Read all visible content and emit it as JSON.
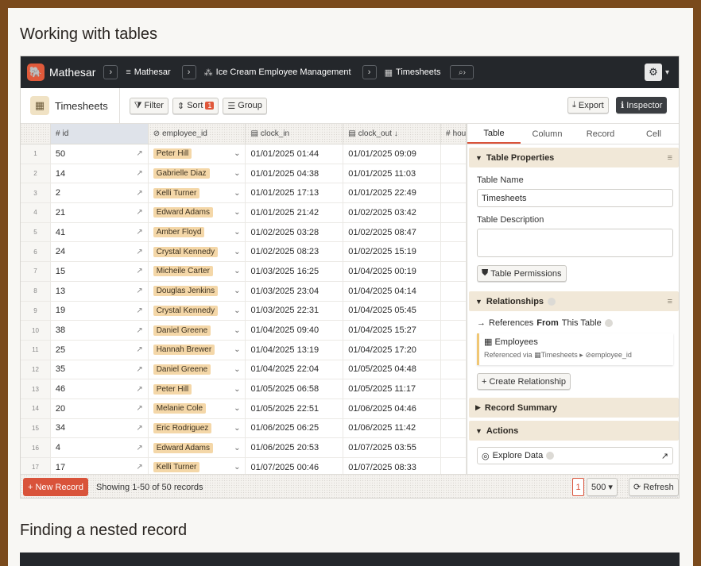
{
  "headings": {
    "working": "Working with tables",
    "finding": "Finding a nested record"
  },
  "topbar": {
    "brand": "Mathesar",
    "crumbs": [
      {
        "icon": "database-icon",
        "glyph": "≡",
        "label": "Mathesar"
      },
      {
        "icon": "schema-icon",
        "glyph": "⁂",
        "label": "Ice Cream Employee Management"
      },
      {
        "icon": "table-icon",
        "glyph": "▦",
        "label": "Timesheets"
      }
    ]
  },
  "toolbar": {
    "table_name": "Timesheets",
    "filter": "Filter",
    "sort": "Sort",
    "sort_count": "1",
    "group": "Group",
    "export": "Export",
    "inspector": "Inspector"
  },
  "columns": [
    {
      "glyph": "#",
      "label": "id"
    },
    {
      "glyph": "⊘",
      "label": "employee_id"
    },
    {
      "glyph": "▤",
      "label": "clock_in"
    },
    {
      "glyph": "▤",
      "label": "clock_out ↓"
    },
    {
      "glyph": "#",
      "label": "hou"
    }
  ],
  "rows": [
    {
      "n": "1",
      "id": "50",
      "emp": "Peter Hill",
      "in": "01/01/2025 01:44",
      "out": "01/01/2025 09:09"
    },
    {
      "n": "2",
      "id": "14",
      "emp": "Gabrielle Diaz",
      "in": "01/01/2025 04:38",
      "out": "01/01/2025 11:03"
    },
    {
      "n": "3",
      "id": "2",
      "emp": "Kelli Turner",
      "in": "01/01/2025 17:13",
      "out": "01/01/2025 22:49"
    },
    {
      "n": "4",
      "id": "21",
      "emp": "Edward Adams",
      "in": "01/01/2025 21:42",
      "out": "01/02/2025 03:42"
    },
    {
      "n": "5",
      "id": "41",
      "emp": "Amber Floyd",
      "in": "01/02/2025 03:28",
      "out": "01/02/2025 08:47"
    },
    {
      "n": "6",
      "id": "24",
      "emp": "Crystal Kennedy",
      "in": "01/02/2025 08:23",
      "out": "01/02/2025 15:19"
    },
    {
      "n": "7",
      "id": "15",
      "emp": "Micheile Carter",
      "in": "01/03/2025 16:25",
      "out": "01/04/2025 00:19"
    },
    {
      "n": "8",
      "id": "13",
      "emp": "Douglas Jenkins",
      "in": "01/03/2025 23:04",
      "out": "01/04/2025 04:14"
    },
    {
      "n": "9",
      "id": "19",
      "emp": "Crystal Kennedy",
      "in": "01/03/2025 22:31",
      "out": "01/04/2025 05:45"
    },
    {
      "n": "10",
      "id": "38",
      "emp": "Daniel Greene",
      "in": "01/04/2025 09:40",
      "out": "01/04/2025 15:27"
    },
    {
      "n": "11",
      "id": "25",
      "emp": "Hannah Brewer",
      "in": "01/04/2025 13:19",
      "out": "01/04/2025 17:20"
    },
    {
      "n": "12",
      "id": "35",
      "emp": "Daniel Greene",
      "in": "01/04/2025 22:04",
      "out": "01/05/2025 04:48"
    },
    {
      "n": "13",
      "id": "46",
      "emp": "Peter Hill",
      "in": "01/05/2025 06:58",
      "out": "01/05/2025 11:17"
    },
    {
      "n": "14",
      "id": "20",
      "emp": "Melanie Cole",
      "in": "01/05/2025 22:51",
      "out": "01/06/2025 04:46"
    },
    {
      "n": "15",
      "id": "34",
      "emp": "Eric Rodriguez",
      "in": "01/06/2025 06:25",
      "out": "01/06/2025 11:42"
    },
    {
      "n": "16",
      "id": "4",
      "emp": "Edward Adams",
      "in": "01/06/2025 20:53",
      "out": "01/07/2025 03:55"
    },
    {
      "n": "17",
      "id": "17",
      "emp": "Kelli Turner",
      "in": "01/07/2025 00:46",
      "out": "01/07/2025 08:33"
    }
  ],
  "footer": {
    "new_record": "New Record",
    "showing": "Showing 1-50 of 50 records",
    "page": "1",
    "page_size": "500",
    "refresh": "Refresh"
  },
  "inspector": {
    "tabs": [
      "Table",
      "Column",
      "Record",
      "Cell"
    ],
    "table_properties": "Table Properties",
    "table_name_label": "Table Name",
    "table_name_value": "Timesheets",
    "table_description_label": "Table Description",
    "table_permissions": "Table Permissions",
    "relationships": "Relationships",
    "references_prefix": "References",
    "references_from": "From",
    "references_suffix": "This Table",
    "ref_table": "Employees",
    "referenced_via": "Referenced via",
    "via_table": "Timesheets",
    "via_column": "employee_id",
    "create_relationship": "Create Relationship",
    "record_summary": "Record Summary",
    "actions": "Actions",
    "explore_data": "Explore Data"
  },
  "colors": {
    "accent": "#d9533a",
    "topbar": "#24272b",
    "pill": "#f4d7a8",
    "section": "#f1e8d8"
  }
}
